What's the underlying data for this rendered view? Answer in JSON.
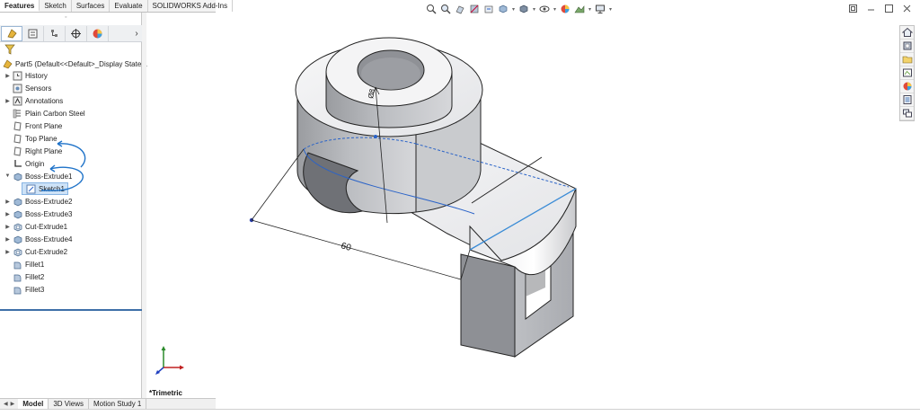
{
  "command_tabs": [
    "Features",
    "Sketch",
    "Surfaces",
    "Evaluate",
    "SOLIDWORKS Add-Ins"
  ],
  "tree": {
    "part": "Part5  (Default<<Default>_Display State 1",
    "items": [
      {
        "label": "History",
        "icon": "history-icon",
        "expandable": true
      },
      {
        "label": "Sensors",
        "icon": "sensors-icon",
        "expandable": false
      },
      {
        "label": "Annotations",
        "icon": "annotations-icon",
        "expandable": true
      },
      {
        "label": "Plain Carbon Steel",
        "icon": "material-icon",
        "expandable": false
      },
      {
        "label": "Front Plane",
        "icon": "plane-icon",
        "expandable": false
      },
      {
        "label": "Top Plane",
        "icon": "plane-icon",
        "expandable": false
      },
      {
        "label": "Right Plane",
        "icon": "plane-icon",
        "expandable": false
      },
      {
        "label": "Origin",
        "icon": "origin-icon",
        "expandable": false
      },
      {
        "label": "Boss-Extrude1",
        "icon": "extrude-icon",
        "expandable": true,
        "expanded": true
      },
      {
        "label": "Sketch1",
        "icon": "sketch-icon",
        "expandable": false,
        "selected": true,
        "child": true
      },
      {
        "label": "Boss-Extrude2",
        "icon": "extrude-icon",
        "expandable": true
      },
      {
        "label": "Boss-Extrude3",
        "icon": "extrude-icon",
        "expandable": true
      },
      {
        "label": "Cut-Extrude1",
        "icon": "cut-extrude-icon",
        "expandable": true
      },
      {
        "label": "Boss-Extrude4",
        "icon": "extrude-icon",
        "expandable": true
      },
      {
        "label": "Cut-Extrude2",
        "icon": "cut-extrude-icon",
        "expandable": true
      },
      {
        "label": "Fillet1",
        "icon": "fillet-icon",
        "expandable": false
      },
      {
        "label": "Fillet2",
        "icon": "fillet-icon",
        "expandable": false
      },
      {
        "label": "Fillet3",
        "icon": "fillet-icon",
        "expandable": false
      }
    ]
  },
  "bottom_tabs": [
    "Model",
    "3D Views",
    "Motion Study 1"
  ],
  "viewport": {
    "view_label": "*Trimetric",
    "dimension_value": "60",
    "diameter_dim": "Ø8"
  },
  "colors": {
    "accent": "#3e6fa8",
    "selection_blue": "#3a8bd6",
    "sketch_blue": "#2a63c8",
    "model_gray": "#a7a9ad"
  }
}
